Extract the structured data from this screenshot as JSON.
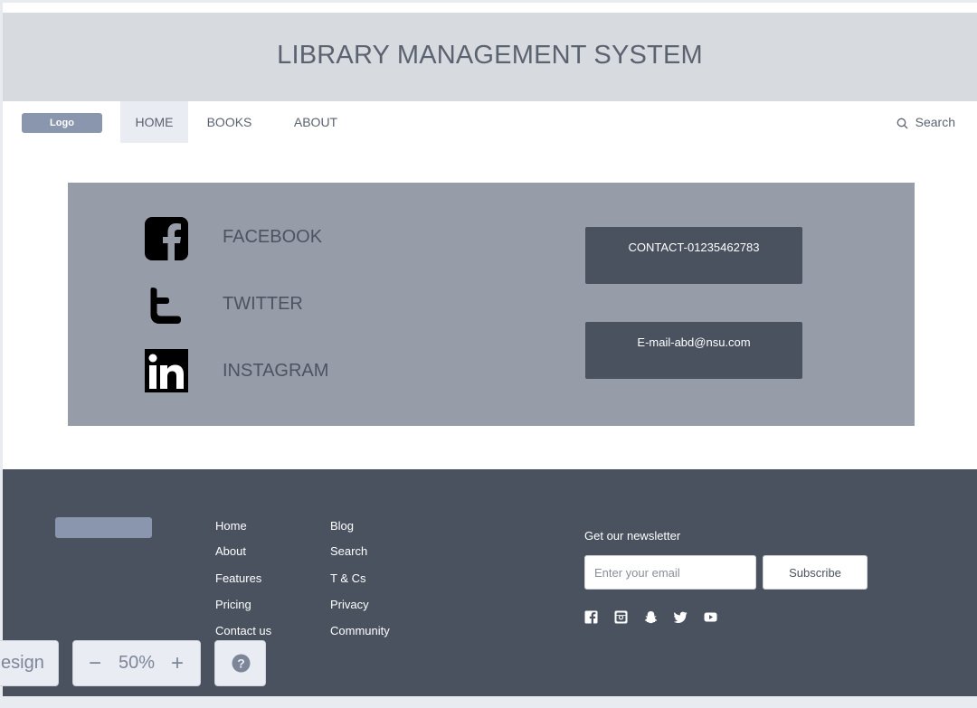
{
  "header": {
    "title": "LIBRARY MANAGEMENT SYSTEM"
  },
  "nav": {
    "logo_label": "Logo",
    "items": [
      {
        "label": "HOME",
        "active": true
      },
      {
        "label": "BOOKS",
        "active": false
      },
      {
        "label": "ABOUT",
        "active": false
      }
    ],
    "search_label": "Search"
  },
  "social": {
    "items": [
      {
        "label": "FACEBOOK",
        "icon": "facebook-icon"
      },
      {
        "label": "TWITTER",
        "icon": "twitter-icon"
      },
      {
        "label": "INSTAGRAM",
        "icon": "linkedin-icon"
      }
    ],
    "contact_label": "CONTACT-01235462783",
    "email_label": "E-mail-abd@nsu.com"
  },
  "footer": {
    "col1": [
      "Home",
      "About",
      "Features",
      "Pricing",
      "Contact us"
    ],
    "col2": [
      "Blog",
      "Search",
      "T & Cs",
      "Privacy",
      "Community"
    ],
    "newsletter_label": "Get our newsletter",
    "email_placeholder": "Enter your email",
    "subscribe_label": "Subscribe",
    "social_icons": [
      "facebook-icon",
      "instagram-icon",
      "snapchat-icon",
      "twitter-icon",
      "youtube-icon"
    ]
  },
  "toolbar": {
    "design_label": "esign",
    "zoom_out": "−",
    "zoom_level": "50%",
    "zoom_in": "+",
    "help": "?"
  },
  "colors": {
    "title_band": "#d7dade",
    "panel": "#979da8",
    "footer": "#4a5260",
    "accent": "#8a96ad"
  }
}
